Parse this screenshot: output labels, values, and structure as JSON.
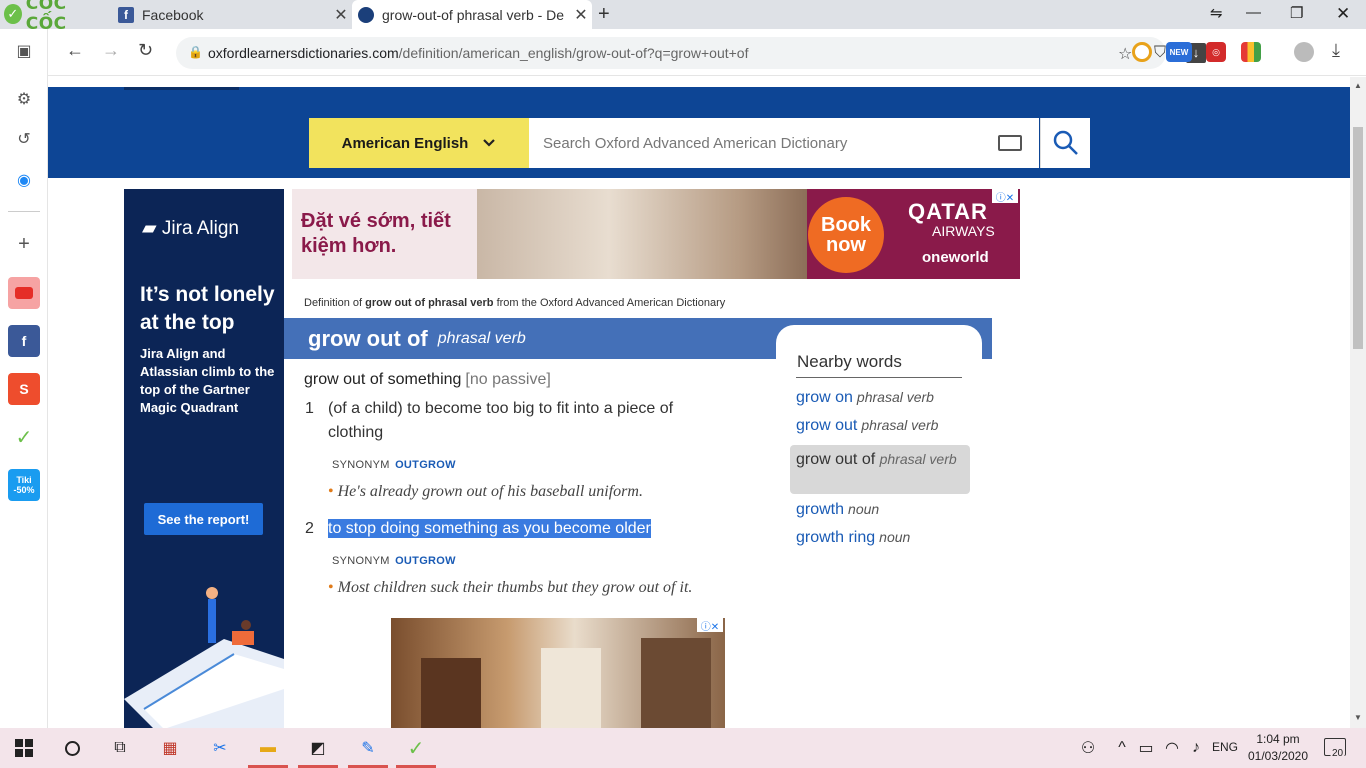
{
  "browser": {
    "logo_text": "CỐC CỐC",
    "tabs": [
      {
        "title": "Facebook"
      },
      {
        "title": "grow-out-of phrasal verb - De"
      }
    ],
    "url_host": "oxfordlearnersdictionaries.com",
    "url_path": "/definition/american_english/grow-out-of?q=grow+out+of",
    "ext_new_badge": "NEW",
    "sidebar_tiki_label": "Tiki",
    "sidebar_tiki_sub": "-50%"
  },
  "site": {
    "dictionary_select": "American English",
    "search_placeholder": "Search Oxford Advanced American Dictionary"
  },
  "ad_left": {
    "logo": "Jira Align",
    "headline": "It’s not lonely at the top",
    "body": "Jira Align and Atlassian climb to the top of the Gartner Magic Quadrant",
    "cta": "See the report!"
  },
  "ad_top": {
    "promo": "Đặt vé sớm, tiết kiệm hơn.",
    "cta": "Book now",
    "brand": "QATAR",
    "brand_sub": "AIRWAYS",
    "alliance": "oneworld"
  },
  "entry": {
    "caption_prefix": "Definition of ",
    "caption_word": "grow out of phrasal verb",
    "caption_suffix": " from the Oxford Advanced American Dictionary",
    "headword": "grow out of",
    "pos": "phrasal verb",
    "idiom": "grow out of something",
    "grammar": "[no passive]",
    "senses": [
      {
        "num": "1",
        "definition": "(of a child) to become too big to fit into a piece of clothing",
        "synonym_label": "SYNONYM",
        "synonym": "OUTGROW",
        "example": "He's already grown out of his baseball uniform."
      },
      {
        "num": "2",
        "definition": "to stop doing something as you become older",
        "synonym_label": "SYNONYM",
        "synonym": "OUTGROW",
        "example": "Most children suck their thumbs but they grow out of it."
      }
    ]
  },
  "nearby": {
    "title": "Nearby words",
    "items": [
      {
        "word": "grow on",
        "pos": "phrasal verb"
      },
      {
        "word": "grow out",
        "pos": "phrasal verb"
      },
      {
        "word": "grow out of",
        "pos": "phrasal verb"
      },
      {
        "word": "growth",
        "pos": "noun"
      },
      {
        "word": "growth ring",
        "pos": "noun"
      }
    ]
  },
  "taskbar": {
    "language": "ENG",
    "time": "1:04 pm",
    "date": "01/03/2020",
    "notifications": "20"
  },
  "colors": {
    "header_blue": "#0d4595",
    "headword_bar": "#4470b8",
    "dict_select_yellow": "#f2e35d",
    "link_blue": "#1a5bb5",
    "selection_blue": "#3a7be0"
  }
}
